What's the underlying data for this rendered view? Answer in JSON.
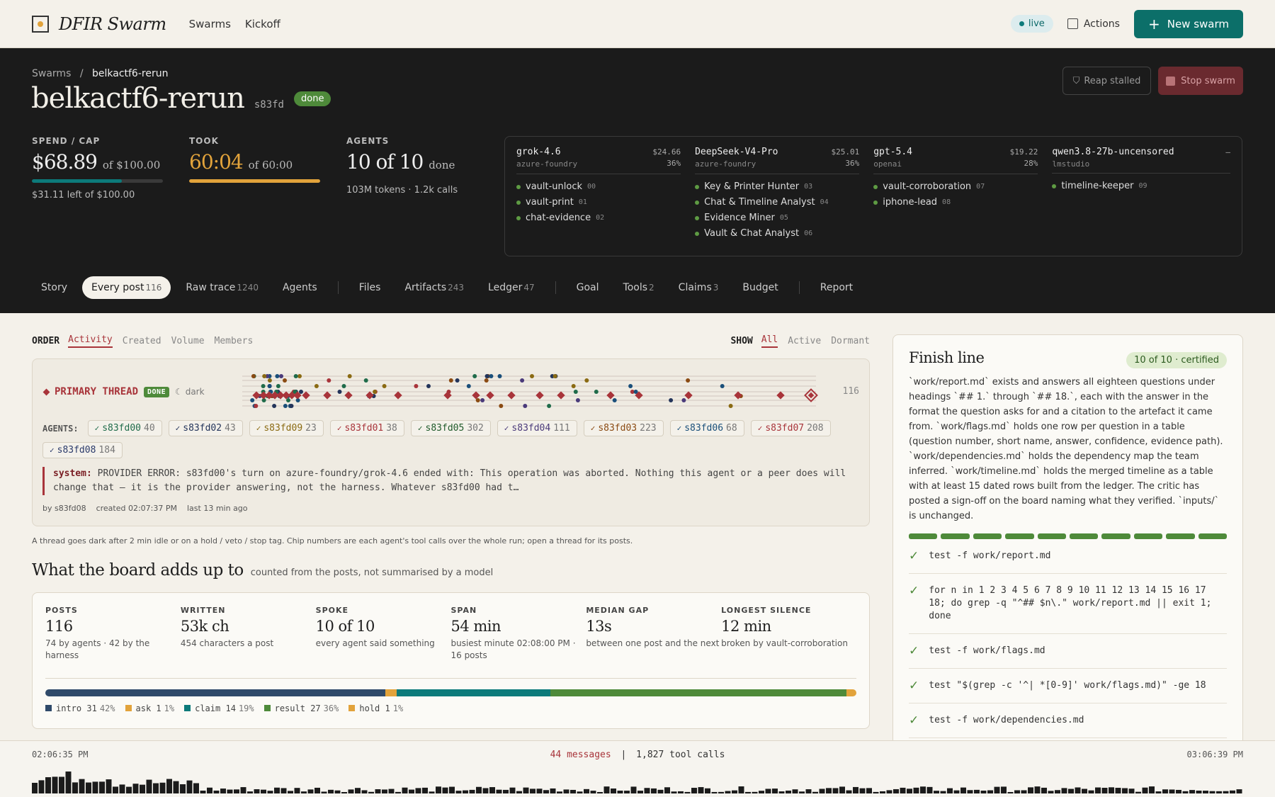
{
  "app": {
    "title": "DFIR Swarm",
    "nav": [
      "Swarms",
      "Kickoff"
    ],
    "live": "live",
    "actions": "Actions",
    "new_swarm": "New swarm"
  },
  "breadcrumb": {
    "root": "Swarms",
    "sep": "/",
    "current": "belkactf6-rerun"
  },
  "swarm": {
    "title": "belkactf6-rerun",
    "id": "s83fd",
    "status": "done",
    "reap": "Reap stalled",
    "stop": "Stop swarm"
  },
  "stats": {
    "spend": {
      "label": "SPEND / CAP",
      "value": "$68.89",
      "of": "of $100.00",
      "sub": "$31.11 left of $100.00",
      "fraction": 0.6889,
      "color": "#0c7a7a"
    },
    "took": {
      "label": "TOOK",
      "value": "60:04",
      "of": "of 60:00",
      "fraction": 1.0,
      "color": "#e2a33b"
    },
    "agents": {
      "label": "AGENTS",
      "value": "10 of 10",
      "of": "done",
      "sub": "103M tokens · 1.2k calls"
    }
  },
  "models": [
    {
      "name": "grok-4.6",
      "provider": "azure-foundry",
      "cost": "$24.66",
      "pct": "36%",
      "agents": [
        {
          "name": "vault-unlock",
          "num": "00"
        },
        {
          "name": "vault-print",
          "num": "01"
        },
        {
          "name": "chat-evidence",
          "num": "02"
        }
      ]
    },
    {
      "name": "DeepSeek-V4-Pro",
      "provider": "azure-foundry",
      "cost": "$25.01",
      "pct": "36%",
      "agents": [
        {
          "name": "Key & Printer Hunter",
          "num": "03"
        },
        {
          "name": "Chat & Timeline Analyst",
          "num": "04"
        },
        {
          "name": "Evidence Miner",
          "num": "05"
        },
        {
          "name": "Vault & Chat Analyst",
          "num": "06"
        }
      ]
    },
    {
      "name": "gpt-5.4",
      "provider": "openai",
      "cost": "$19.22",
      "pct": "28%",
      "agents": [
        {
          "name": "vault-corroboration",
          "num": "07"
        },
        {
          "name": "iphone-lead",
          "num": "08"
        }
      ]
    },
    {
      "name": "qwen3.8-27b-uncensored",
      "provider": "lmstudio",
      "cost": "–",
      "pct": "",
      "agents": [
        {
          "name": "timeline-keeper",
          "num": "09"
        }
      ]
    }
  ],
  "tabs": [
    {
      "label": "Story",
      "count": ""
    },
    {
      "label": "Every post",
      "count": "116",
      "active": true
    },
    {
      "label": "Raw trace",
      "count": "1240"
    },
    {
      "label": "Agents",
      "count": ""
    },
    {
      "sep": true
    },
    {
      "label": "Files",
      "count": ""
    },
    {
      "label": "Artifacts",
      "count": "243"
    },
    {
      "label": "Ledger",
      "count": "47"
    },
    {
      "sep": true
    },
    {
      "label": "Goal",
      "count": ""
    },
    {
      "label": "Tools",
      "count": "2"
    },
    {
      "label": "Claims",
      "count": "3"
    },
    {
      "label": "Budget",
      "count": ""
    },
    {
      "sep": true
    },
    {
      "label": "Report",
      "count": ""
    }
  ],
  "order": {
    "label": "ORDER",
    "options": [
      "Activity",
      "Created",
      "Volume",
      "Members"
    ],
    "selected": 0
  },
  "show": {
    "label": "SHOW",
    "options": [
      "All",
      "Active",
      "Dormant"
    ],
    "selected": 0
  },
  "thread": {
    "title": "PRIMARY THREAD",
    "status": "DONE",
    "dark": "dark",
    "count": "116",
    "agents_label": "AGENTS:",
    "agents": [
      {
        "id": "s83fd00",
        "n": "40",
        "color": "#1f6b4a"
      },
      {
        "id": "s83fd02",
        "n": "43",
        "color": "#23345a"
      },
      {
        "id": "s83fd09",
        "n": "23",
        "color": "#8a6a12"
      },
      {
        "id": "s83fd01",
        "n": "38",
        "color": "#a8343a"
      },
      {
        "id": "s83fd05",
        "n": "302",
        "color": "#1f5a2a"
      },
      {
        "id": "s83fd04",
        "n": "111",
        "color": "#4a3a7a"
      },
      {
        "id": "s83fd03",
        "n": "223",
        "color": "#8a4a12"
      },
      {
        "id": "s83fd06",
        "n": "68",
        "color": "#1a4f7a"
      },
      {
        "id": "s83fd07",
        "n": "208",
        "color": "#a8343a"
      },
      {
        "id": "s83fd08",
        "n": "184",
        "color": "#2a3a6a"
      }
    ],
    "message": {
      "who": "system:",
      "text": "PROVIDER ERROR: s83fd00's turn on azure-foundry/grok-4.6 ended with: This operation was aborted. Nothing this agent or a peer does will change that — it is the provider answering, not the harness. Whatever s83fd00 had t…"
    },
    "meta": {
      "by": "by s83fd08",
      "created": "created 02:07:37 PM",
      "last": "last 13 min ago"
    }
  },
  "hint": "A thread goes dark after 2 min idle or on a hold / veto / stop tag. Chip numbers are each agent's tool calls over the whole run; open a thread for its posts.",
  "board": {
    "title": "What the board adds up to",
    "subtitle": "counted from the posts, not summarised by a model",
    "metrics": [
      {
        "label": "POSTS",
        "value": "116",
        "desc": "74 by agents · 42 by the harness"
      },
      {
        "label": "WRITTEN",
        "value": "53k ch",
        "desc": "454 characters a post"
      },
      {
        "label": "SPOKE",
        "value": "10 of 10",
        "desc": "every agent said something"
      },
      {
        "label": "SPAN",
        "value": "54 min",
        "desc": "busiest minute 02:08:00 PM · 16 posts"
      },
      {
        "label": "MEDIAN GAP",
        "value": "13s",
        "desc": "between one post and the next"
      },
      {
        "label": "LONGEST SILENCE",
        "value": "12 min",
        "desc": "broken by vault-corroboration"
      }
    ],
    "distribution": [
      {
        "kind": "intro",
        "count": "31",
        "pct": "42%",
        "share": 42,
        "color": "#2f4a6a"
      },
      {
        "kind": "ask",
        "count": "1",
        "pct": "1%",
        "share": 1.4,
        "color": "#e2a33b"
      },
      {
        "kind": "claim",
        "count": "14",
        "pct": "19%",
        "share": 19,
        "color": "#0c7a7a"
      },
      {
        "kind": "result",
        "count": "27",
        "pct": "36%",
        "share": 36.6,
        "color": "#4e8a3a"
      },
      {
        "kind": "hold",
        "count": "1",
        "pct": "1%",
        "share": 1.2,
        "color": "#e2a33b"
      }
    ]
  },
  "finish": {
    "title": "Finish line",
    "badge": "10 of 10 · certified",
    "text": "`work/report.md` exists and answers all eighteen questions under headings `## 1.` through `## 18.`, each with the answer in the format the question asks for and a citation to the artefact it came from. `work/flags.md` holds one row per question in a table (question number, short name, answer, confidence, evidence path). `work/dependencies.md` holds the dependency map the team inferred. `work/timeline.md` holds the merged timeline as a table with at least 15 dated rows built from the ledger. The critic has posted a sign-off on the board naming what they verified. `inputs/` is unchanged.",
    "segments": 10,
    "checks": [
      "test -f work/report.md",
      "for n in 1 2 3 4 5 6 7 8 9 10 11 12 13 14 15 16 17 18; do grep -q \"^## $n\\.\" work/report.md || exit 1; done",
      "test -f work/flags.md",
      "test \"$(grep -c '^| *[0-9]' work/flags.md)\" -ge 18",
      "test -f work/dependencies.md"
    ]
  },
  "bottom": {
    "start": "02:06:35 PM",
    "end": "03:06:39 PM",
    "messages": "44 messages",
    "sep": "|",
    "tools": "1,827 tool calls"
  },
  "colors": {
    "accent": "#0c6f69",
    "danger": "#a8343a",
    "ok": "#4e8a3a"
  }
}
